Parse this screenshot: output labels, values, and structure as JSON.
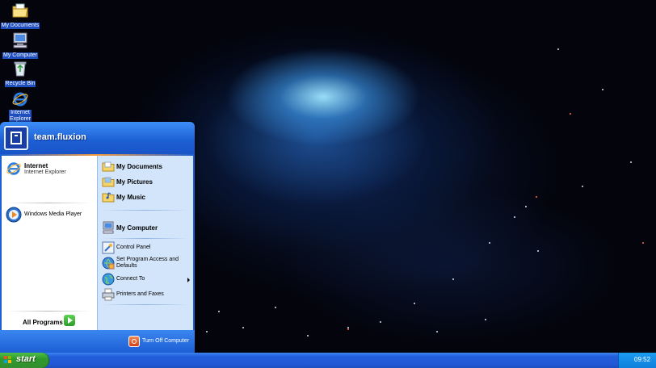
{
  "desktop": {
    "icons": [
      {
        "label": "My Documents",
        "icon": "my-documents-icon"
      },
      {
        "label": "My Computer",
        "icon": "my-computer-icon"
      },
      {
        "label": "Recycle Bin",
        "icon": "recycle-bin-icon"
      },
      {
        "label_line1": "Internet",
        "label_line2": "Explorer",
        "icon": "internet-explorer-icon"
      }
    ]
  },
  "start_menu": {
    "username": "team.fluxion",
    "pinned": {
      "title": "Internet",
      "subtitle": "Internet Explorer"
    },
    "recent": [
      {
        "label": "Windows Media Player",
        "icon": "media-player-icon"
      }
    ],
    "all_programs": "All Programs",
    "right_column": {
      "my_documents": "My Documents",
      "my_pictures": "My Pictures",
      "my_music": "My Music",
      "my_computer": "My Computer",
      "control_panel": "Control Panel",
      "set_program_line1": "Set Program Access and",
      "set_program_line2": "Defaults",
      "connect_to": "Connect To",
      "printers": "Printers and Faxes"
    },
    "turn_off": "Turn Off Computer"
  },
  "taskbar": {
    "start_label": "start",
    "clock": "09:52"
  },
  "colors": {
    "taskbar_blue": "#245edb",
    "start_green": "#2f9a2c",
    "menu_right_panel": "#d3e5fa",
    "label_highlight": "#1f4fbf"
  }
}
